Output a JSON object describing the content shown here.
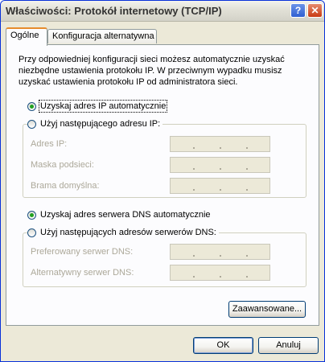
{
  "window": {
    "title": "Właściwości: Protokół internetowy (TCP/IP)",
    "help_glyph": "?",
    "close_glyph": "✕"
  },
  "tabs": [
    {
      "label": "Ogólne",
      "active": true
    },
    {
      "label": "Konfiguracja alternatywna",
      "active": false
    }
  ],
  "description": "Przy odpowiedniej konfiguracji sieci możesz automatycznie uzyskać niezbędne ustawienia protokołu IP. W przeciwnym wypadku musisz uzyskać ustawienia protokołu IP od administratora sieci.",
  "ip_options": {
    "auto": "Uzyskaj adres IP automatycznie",
    "manual": "Użyj następującego adresu IP:",
    "fields": [
      "Adres IP:",
      "Maska podsieci:",
      "Brama domyślna:"
    ]
  },
  "dns_options": {
    "auto": "Uzyskaj adres serwera DNS automatycznie",
    "manual": "Użyj następujących adresów serwerów DNS:",
    "fields": [
      "Preferowany serwer DNS:",
      "Alternatywny serwer DNS:"
    ]
  },
  "buttons": {
    "advanced": "Zaawansowane...",
    "ok": "OK",
    "cancel": "Anuluj"
  },
  "colors": {
    "accent_tab": "#e68b2c",
    "radio_checked": "#21a121",
    "window_face": "#ece9d8"
  }
}
